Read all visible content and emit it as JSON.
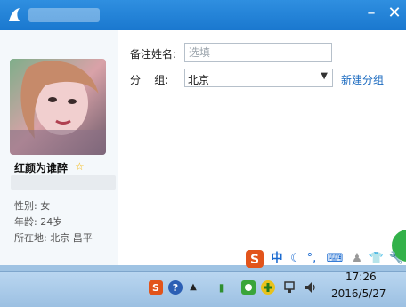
{
  "window": {
    "title": "",
    "minimize_glyph": "–",
    "close_glyph": "✕"
  },
  "profile": {
    "nickname": "红颜为谁醉",
    "gender": "性别: 女",
    "age": "年龄: 24岁",
    "location": "所在地: 北京  昌平"
  },
  "form": {
    "remark_label": "备注姓名:",
    "remark_placeholder": "选填",
    "group_label": "分    组:",
    "group_value": "北京",
    "new_group_link": "新建分组"
  },
  "ime_bar": {
    "mode_text": "中",
    "icons": [
      "sogou-logo-icon",
      "chinese-mode",
      "moon-icon",
      "punctuation-icon",
      "keyboard-icon",
      "user-icon",
      "shirt-icon",
      "wrench-icon"
    ]
  },
  "taskbar": {
    "time": "17:26",
    "date": "2016/5/27",
    "colors": {
      "accent": "#1a78cf",
      "ime_red": "#e2541b"
    }
  }
}
